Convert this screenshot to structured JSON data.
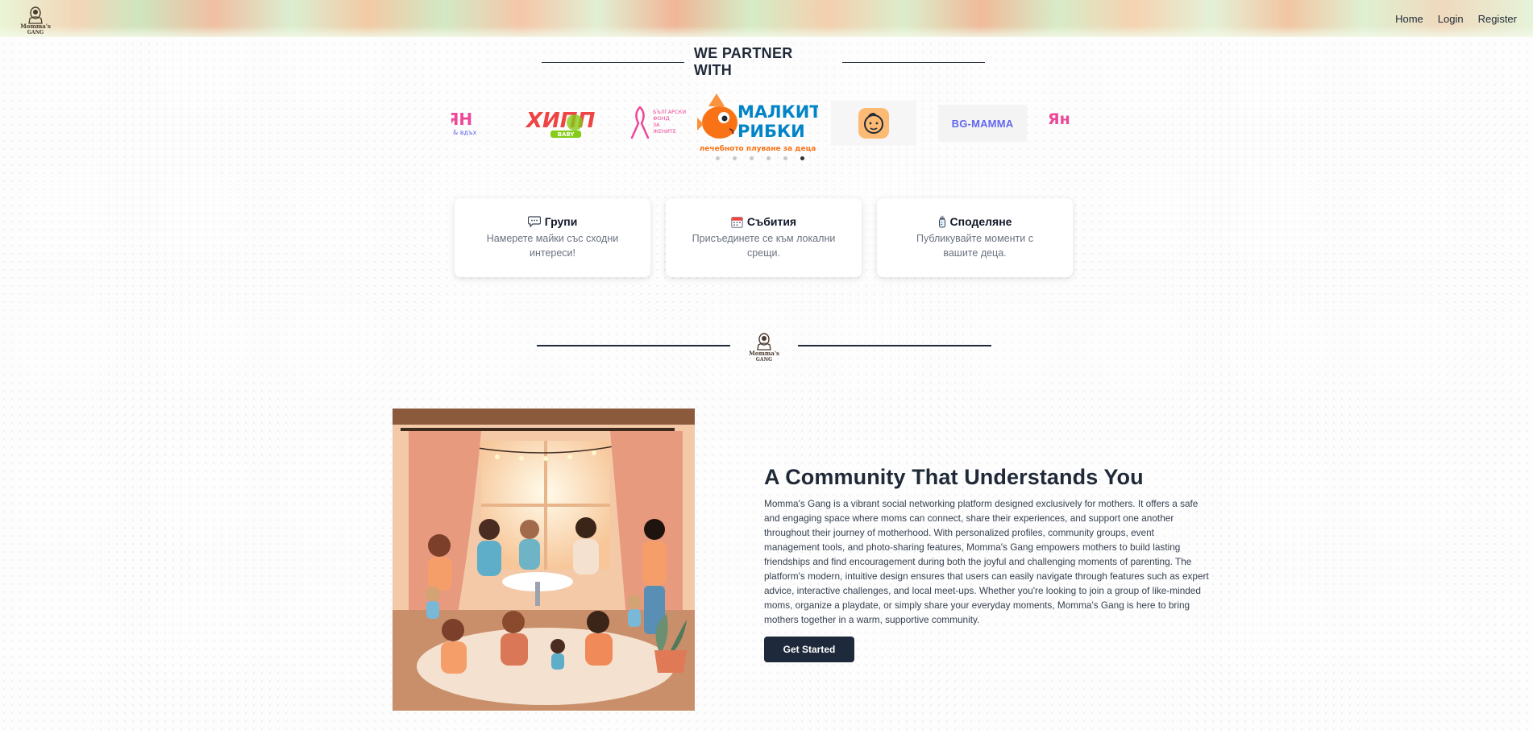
{
  "header": {
    "logo_alt": "Momma's Gang",
    "logo_text": "Momma's Gang",
    "nav": [
      {
        "label": "Home"
      },
      {
        "label": "Login"
      },
      {
        "label": "Register"
      }
    ]
  },
  "partners": {
    "title": "WE PARTNER WITH",
    "logos": [
      {
        "name": "partner-yan",
        "text_main": "ЯН",
        "text_sub": "& вдъх"
      },
      {
        "name": "partner-hipp",
        "text_main": "ХИПП",
        "text_sub": "BABY"
      },
      {
        "name": "partner-breast-cancer-fund",
        "text_main": "БЪЛГАРСКИ ФОНД ЗА ЖЕНИТЕ"
      },
      {
        "name": "partner-malkite-ribki",
        "text_main": "МАЛКИТЕ",
        "text_main2": "РИБКИ",
        "text_sub": "лечебното плуване за деца"
      },
      {
        "name": "partner-baby-app"
      },
      {
        "name": "partner-bg-mamma",
        "text_main": "BG-MAMMA"
      },
      {
        "name": "partner-yan-2",
        "text_main": "Ян"
      }
    ],
    "dot_count": 6,
    "active_dot": 5
  },
  "features": [
    {
      "icon": "chat-bubble-icon",
      "title": "Групи",
      "desc": "Намерете майки със сходни интереси!"
    },
    {
      "icon": "calendar-icon",
      "title": "Събития",
      "desc": "Присъединете се към локални срещи."
    },
    {
      "icon": "baby-bottle-icon",
      "title": "Споделяне",
      "desc": "Публикувайте моменти с вашите деца."
    }
  ],
  "community": {
    "title": "A Community That Understands You",
    "body": "Momma's Gang is a vibrant social networking platform designed exclusively for mothers. It offers a safe and engaging space where moms can connect, share their experiences, and support one another throughout their journey of motherhood. With personalized profiles, community groups, event management tools, and photo-sharing features, Momma's Gang empowers mothers to build lasting friendships and find encouragement during both the joyful and challenging moments of parenting. The platform's modern, intuitive design ensures that users can easily navigate through features such as expert advice, interactive challenges, and local meet-ups. Whether you're looking to join a group of like-minded moms, organize a playdate, or simply share your everyday moments, Momma's Gang is here to bring mothers together in a warm, supportive community.",
    "cta": "Get Started"
  },
  "colors": {
    "primary_dark": "#1e293b",
    "text": "#1f2937",
    "muted": "#6b7280",
    "pink": "#ec4899",
    "orange": "#f97316",
    "blue": "#0284c7"
  }
}
